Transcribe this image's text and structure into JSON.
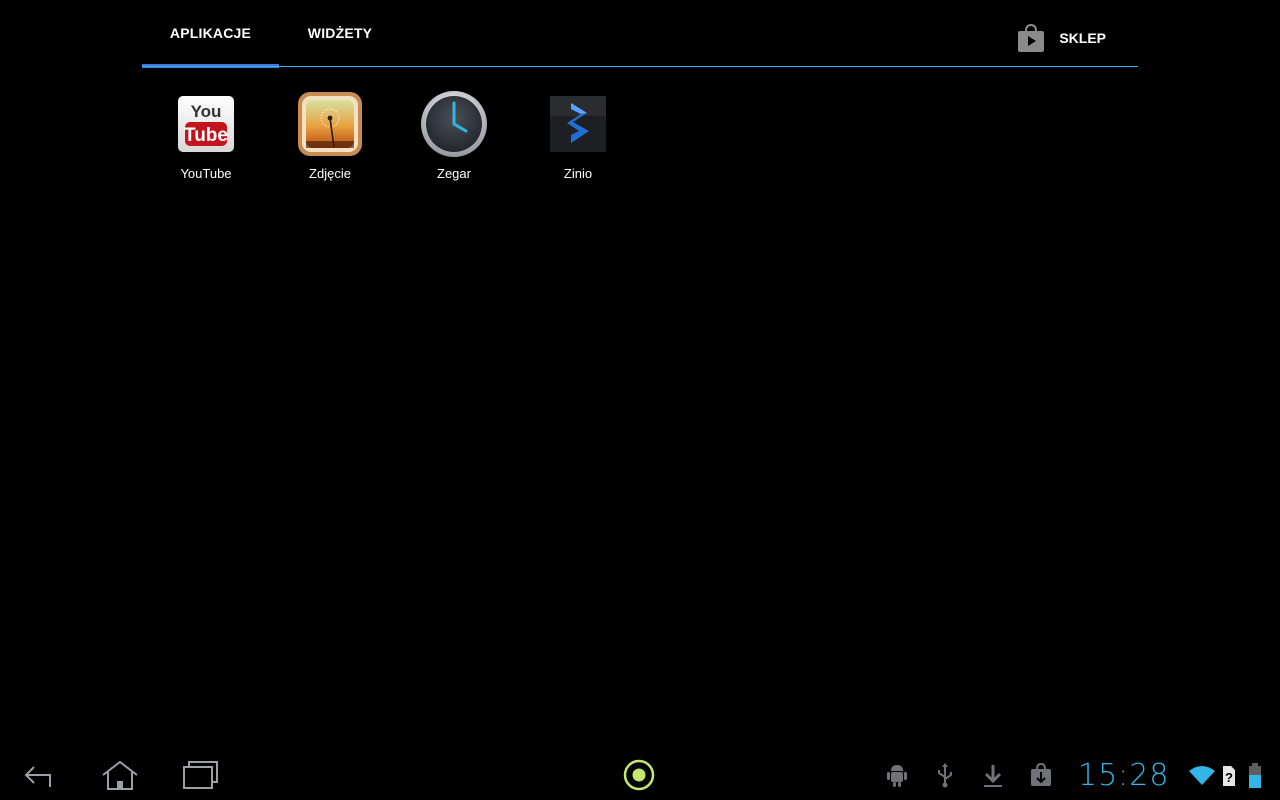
{
  "tabs": {
    "apps_label": "APLIKACJE",
    "widgets_label": "WIDŻETY",
    "store_label": "SKLEP",
    "active": "apps"
  },
  "apps": [
    {
      "label": "YouTube",
      "icon": "youtube-icon"
    },
    {
      "label": "Zdjęcie",
      "icon": "photo-icon"
    },
    {
      "label": "Zegar",
      "icon": "clock-icon"
    },
    {
      "label": "Zinio",
      "icon": "zinio-icon"
    }
  ],
  "system_bar": {
    "nav": [
      "back-icon",
      "home-icon",
      "recent-apps-icon"
    ],
    "center": "camera-shutter-icon",
    "status_icons": [
      "android-debug-icon",
      "usb-icon",
      "download-icon",
      "store-download-icon",
      "wifi-icon",
      "no-sim-icon",
      "battery-icon"
    ],
    "time": "15:28"
  },
  "colors": {
    "accent": "#33b5e5",
    "tab_indicator": "#3f78d6",
    "center_button": "#c5e86c"
  }
}
